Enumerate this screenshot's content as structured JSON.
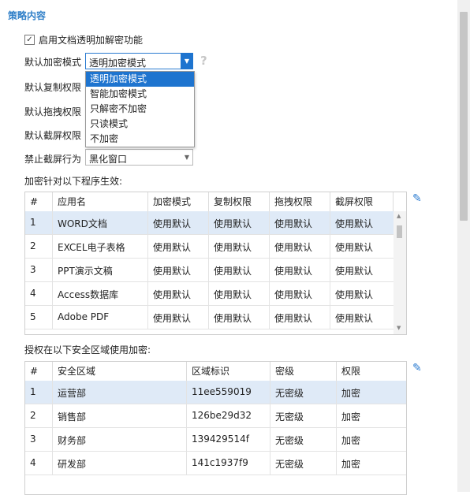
{
  "section_title": "策略内容",
  "enable_checkbox": {
    "label": "启用文档透明加解密功能",
    "checked": true
  },
  "fields": {
    "encrypt_mode": {
      "label": "默认加密模式",
      "value": "透明加密模式"
    },
    "copy": {
      "label": "默认复制权限"
    },
    "drag": {
      "label": "默认拖拽权限"
    },
    "screenshot": {
      "label": "默认截屏权限"
    },
    "block_screenshot": {
      "label": "禁止截屏行为",
      "value": "黑化窗口"
    }
  },
  "dropdown_options": [
    "透明加密模式",
    "智能加密模式",
    "只解密不加密",
    "只读模式",
    "不加密"
  ],
  "program_table": {
    "caption": "加密针对以下程序生效:",
    "headers": [
      "#",
      "应用名",
      "加密模式",
      "复制权限",
      "拖拽权限",
      "截屏权限"
    ],
    "rows": [
      [
        "1",
        "WORD文档",
        "使用默认",
        "使用默认",
        "使用默认",
        "使用默认"
      ],
      [
        "2",
        "EXCEL电子表格",
        "使用默认",
        "使用默认",
        "使用默认",
        "使用默认"
      ],
      [
        "3",
        "PPT演示文稿",
        "使用默认",
        "使用默认",
        "使用默认",
        "使用默认"
      ],
      [
        "4",
        "Access数据库",
        "使用默认",
        "使用默认",
        "使用默认",
        "使用默认"
      ],
      [
        "5",
        "Adobe PDF",
        "使用默认",
        "使用默认",
        "使用默认",
        "使用默认"
      ]
    ]
  },
  "zone_table": {
    "caption": "授权在以下安全区域使用加密:",
    "headers": [
      "#",
      "安全区域",
      "区域标识",
      "密级",
      "权限"
    ],
    "rows": [
      [
        "1",
        "运营部",
        "11ee559019",
        "无密级",
        "加密"
      ],
      [
        "2",
        "销售部",
        "126be29d32",
        "无密级",
        "加密"
      ],
      [
        "3",
        "财务部",
        "139429514f",
        "无密级",
        "加密"
      ],
      [
        "4",
        "研发部",
        "141c1937f9",
        "无密级",
        "加密"
      ]
    ]
  },
  "icons": {
    "help": "question-icon",
    "edit": "pencil-icon",
    "check": "✓"
  },
  "colors": {
    "accent": "#1e74cf",
    "title": "#2f7fc8",
    "selected_row": "#dfeaf7"
  }
}
